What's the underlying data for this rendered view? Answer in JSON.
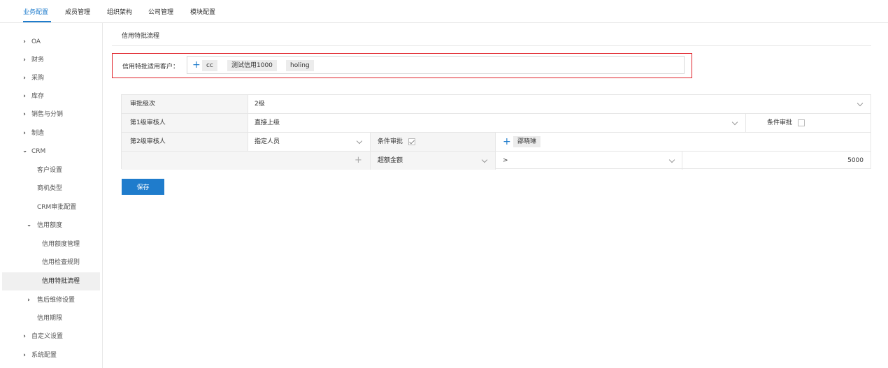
{
  "topnav": {
    "tabs": [
      "业务配置",
      "成员管理",
      "组织架构",
      "公司管理",
      "模块配置"
    ]
  },
  "sidebar": {
    "items": [
      "OA",
      "财务",
      "采购",
      "库存",
      "销售与分销",
      "制造",
      "CRM",
      "客户设置",
      "商机类型",
      "CRM审批配置",
      "信用额度",
      "信用额度管理",
      "信用检查规则",
      "信用特批流程",
      "售后维修设置",
      "信用期限",
      "自定义设置",
      "系统配置"
    ]
  },
  "main": {
    "title": "信用特批流程",
    "customer_label": "信用特批适用客户：",
    "customer_tags": [
      "cc",
      "测试信用1000",
      "holing"
    ]
  },
  "table": {
    "level_label": "审批级次",
    "level_value": "2级",
    "l1_label": "第1级审核人",
    "l1_value": "直接上级",
    "l1_cond": "条件审批",
    "l2_label": "第2级审核人",
    "l2_value": "指定人员",
    "l2_cond": "条件审批",
    "l2_person": "邵晓琳",
    "cond_field": "超额金额",
    "cond_op": ">",
    "cond_amount": "5000"
  },
  "save_label": "保存",
  "colors": {
    "accent": "#1f7ccc",
    "highlight_border": "#e0222a"
  }
}
